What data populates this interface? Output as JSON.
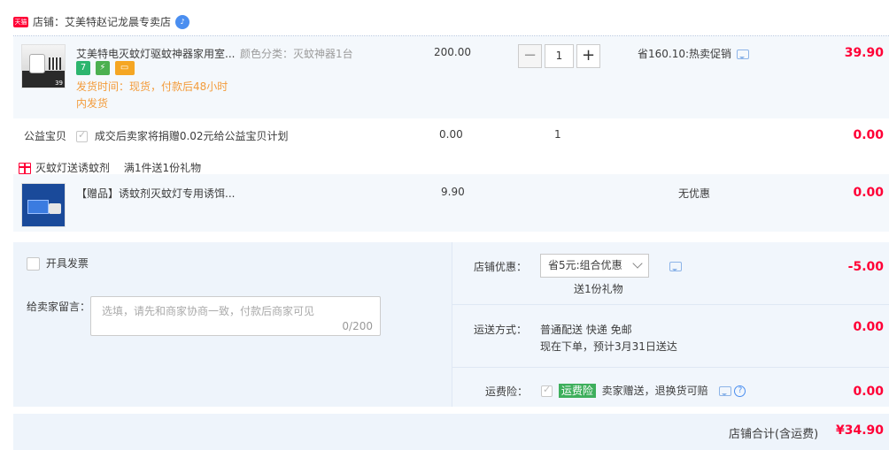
{
  "shop": {
    "badge": "天猫",
    "name": "店铺：艾美特赵记龙晨专卖店",
    "wangwang": "♪"
  },
  "item": {
    "title": "艾美特电灭蚊灯驱蚊神器家用室...",
    "sku": "颜色分类：灭蚊神器1台",
    "badges": [
      "7",
      "⚡",
      "▭"
    ],
    "ship_time": "发货时间：现货，付款后48小时内发货",
    "unit_price": "200.00",
    "quantity": "1",
    "minus": "−",
    "plus": "+",
    "promo": "省160.10:热卖促销",
    "subtotal": "39.90",
    "thumb_price": "39"
  },
  "charity": {
    "label": "公益宝贝",
    "text": "成交后卖家将捐赠0.02元给公益宝贝计划",
    "price": "0.00",
    "quantity": "1",
    "subtotal": "0.00"
  },
  "gift": {
    "header": "灭蚊灯送诱蚊剂",
    "rule": "满1件送1份礼物",
    "title": "【赠品】诱蚊剂灭蚊灯专用诱饵...",
    "price": "9.90",
    "promo": "无优惠",
    "subtotal": "0.00"
  },
  "invoice": {
    "label": "开具发票"
  },
  "message": {
    "label": "给卖家留言：",
    "placeholder": "选填，请先和商家协商一致，付款后商家可见",
    "counter": "0/200"
  },
  "shop_discount": {
    "label": "店铺优惠：",
    "selected": "省5元:组合优惠",
    "sub": "送1份礼物",
    "amount": "-5.00"
  },
  "shipping": {
    "label": "运送方式：",
    "method": "普通配送 快递 免邮",
    "eta": "现在下单，预计3月31日送达",
    "amount": "0.00"
  },
  "insurance": {
    "label": "运费险：",
    "tag": "运费险",
    "text": "卖家赠送，退换货可赔",
    "amount": "0.00"
  },
  "total": {
    "label": "店铺合计(含运费)",
    "amount": "¥34.90"
  },
  "colors": {
    "accent": "#ff0036",
    "panel": "#eef4fb",
    "orange": "#f39c3c"
  }
}
